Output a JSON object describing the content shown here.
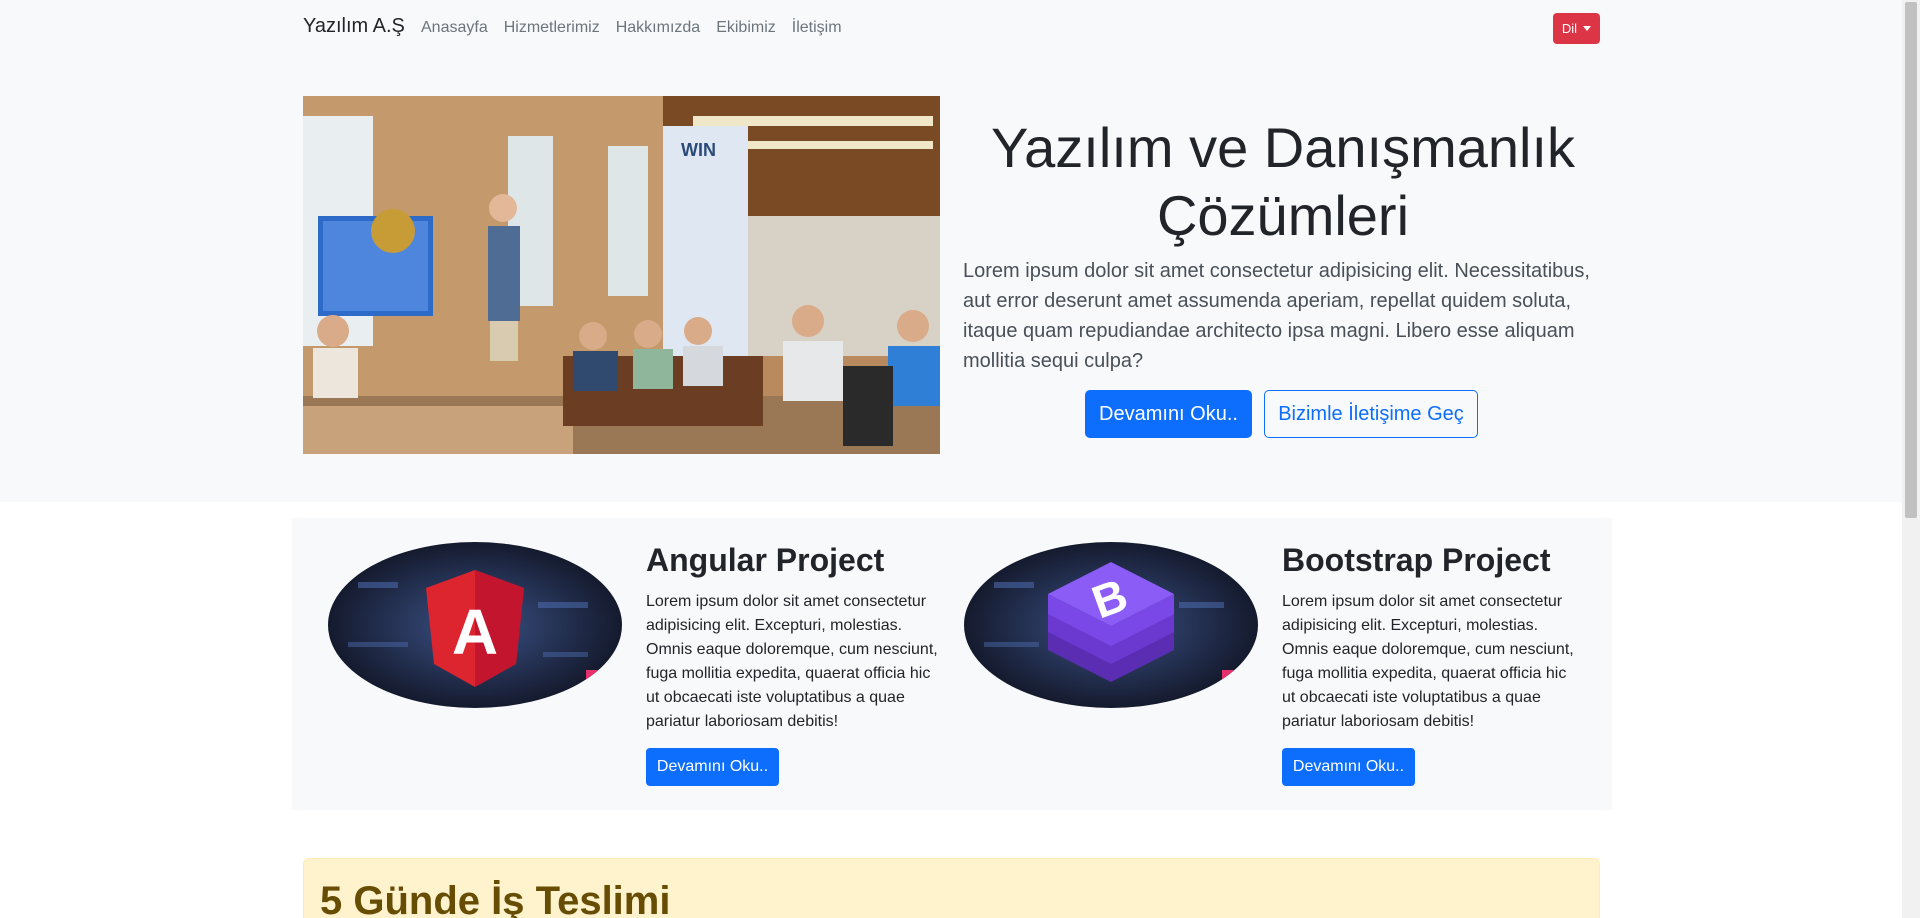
{
  "navbar": {
    "brand": "Yazılım A.Ş",
    "links": [
      "Anasayfa",
      "Hizmetlerimiz",
      "Hakkımızda",
      "Ekibimiz",
      "İletişim"
    ],
    "lang_label": "Dil"
  },
  "hero": {
    "title": "Yazılım ve Danışmanlık Çözümleri",
    "lead": "Lorem ipsum dolor sit amet consectetur adipisicing elit. Necessitatibus, aut error deserunt amet assumenda aperiam, repellat quidem soluta, itaque quam repudiandae architecto ipsa magni. Libero esse aliquam mollitia sequi culpa?",
    "primary_button": "Devamını Oku..",
    "outline_button": "Bizimle İletişime Geç"
  },
  "projects": [
    {
      "title": "Angular Project",
      "text": "Lorem ipsum dolor sit amet consectetur adipisicing elit. Excepturi, molestias. Omnis eaque doloremque, cum nesciunt, fuga mollitia expedita, quaerat officia hic ut obcaecati iste voluptatibus a quae pariatur laboriosam debitis!",
      "button": "Devamını Oku..",
      "logo_letter": "A"
    },
    {
      "title": "Bootstrap Project",
      "text": "Lorem ipsum dolor sit amet consectetur adipisicing elit. Excepturi, molestias. Omnis eaque doloremque, cum nesciunt, fuga mollitia expedita, quaerat officia hic ut obcaecati iste voluptatibus a quae pariatur laboriosam debitis!",
      "button": "Devamını Oku..",
      "logo_letter": "B"
    }
  ],
  "alert": {
    "title": "5 Günde İş Teslimi"
  },
  "colors": {
    "primary": "#0d6efd",
    "danger": "#dc3545",
    "light": "#f8f9fa",
    "warning_bg": "#fff3cd"
  }
}
